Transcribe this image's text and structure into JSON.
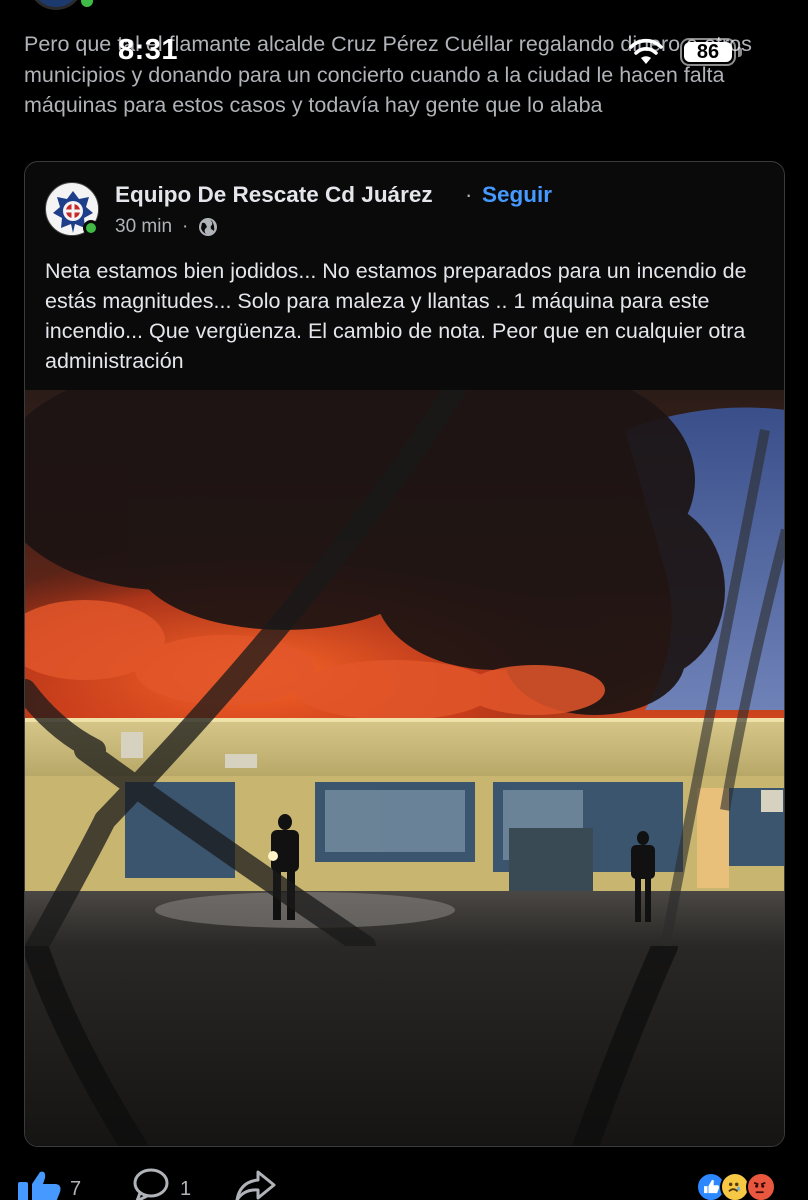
{
  "status_bar": {
    "time": "8:31",
    "battery": "86",
    "icons": [
      "wifi-icon",
      "battery-icon"
    ]
  },
  "post": {
    "text": "Pero que tal el flamante alcalde Cruz Pérez Cuéllar regalando dinero a otros municipios y donando para un concierto cuando a la ciudad le hacen falta máquinas para estos casos y todavía hay gente que lo alaba"
  },
  "shared_post": {
    "page_name": "Equipo De Rescate Cd Juárez",
    "separator": "·",
    "follow_label": "Seguir",
    "time_ago": "30 min",
    "separator_meta": "·",
    "visibility_icon": "globe-icon",
    "body": "Neta estamos bien jodidos... No estamos preparados para un incendio de estás magnitudes... Solo para maleza y llantas .. 1 máquina para este incendio... Que vergüenza. El cambio de nota. Peor que en cualquier otra administración",
    "photo_subject": "building-fire-photo"
  },
  "actions": {
    "like_count": "7",
    "comment_count": "1",
    "reaction_icons": [
      "like-reaction-icon",
      "sad-reaction-icon",
      "angry-reaction-icon"
    ]
  },
  "colors": {
    "background": "#000000",
    "link_blue": "#4599ff",
    "secondary_text": "#b0b3b8",
    "online_green": "#3fbb46"
  }
}
